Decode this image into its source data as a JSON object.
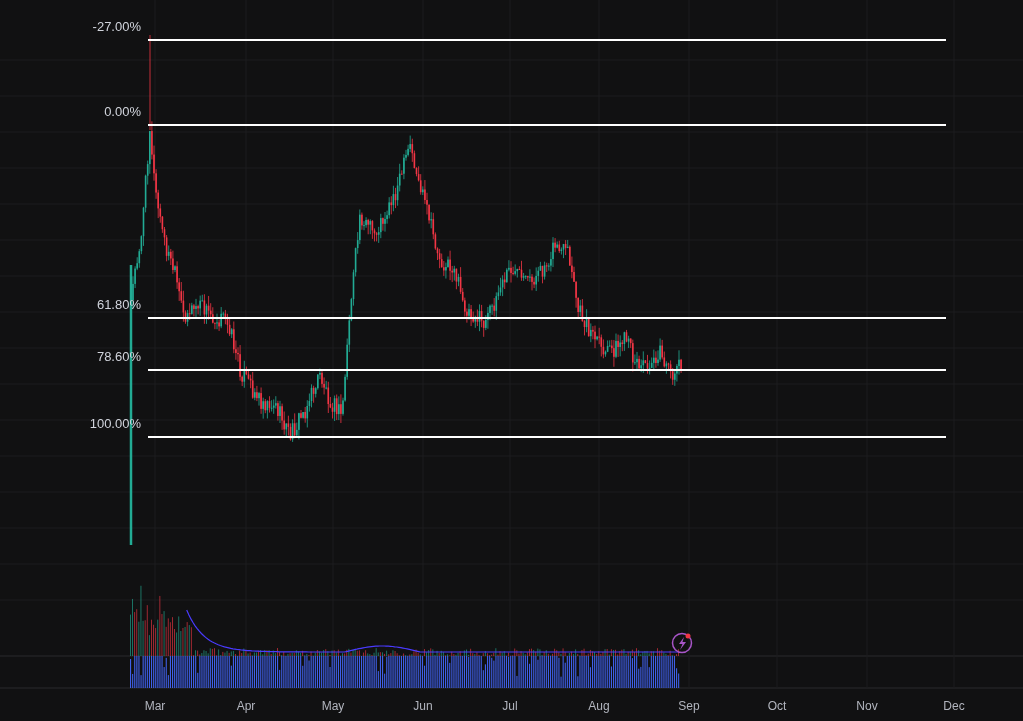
{
  "fib_levels": [
    {
      "label": "-27.00%"
    },
    {
      "label": "0.00%"
    },
    {
      "label": "61.80%"
    },
    {
      "label": "78.60%"
    },
    {
      "label": "100.00%"
    }
  ],
  "x_axis": {
    "labels": [
      "Mar",
      "Apr",
      "May",
      "Jun",
      "Jul",
      "Aug",
      "Sep",
      "Oct",
      "Nov",
      "Dec"
    ]
  }
}
